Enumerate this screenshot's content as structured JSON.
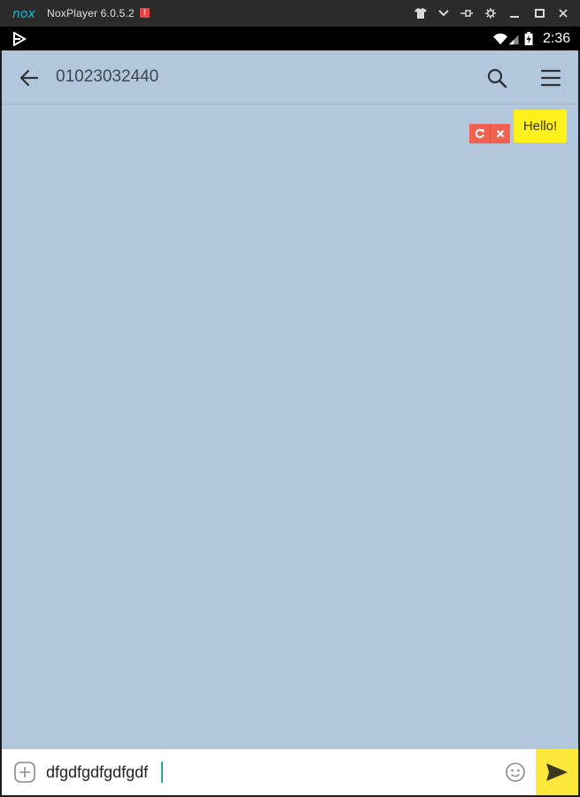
{
  "emulator": {
    "title": "NoxPlayer 6.0.5.2",
    "alert_badge": "!",
    "controls": [
      "shirt-icon",
      "chevron-down-icon",
      "pin-icon",
      "gear-icon",
      "minimize-icon",
      "maximize-icon",
      "close-icon"
    ]
  },
  "status_bar": {
    "time": "2:36"
  },
  "chat": {
    "title": "01023032440",
    "messages": [
      {
        "text": "Hello!",
        "sender": "me"
      }
    ]
  },
  "input": {
    "value": "dfgdfgdfgdfgdf"
  },
  "colors": {
    "chat_background": "#b2c7db",
    "bubble": "#fef01b",
    "send_button": "#fee83c",
    "retry_controls": "#f0614f",
    "nox_accent": "#1fb8d3"
  }
}
